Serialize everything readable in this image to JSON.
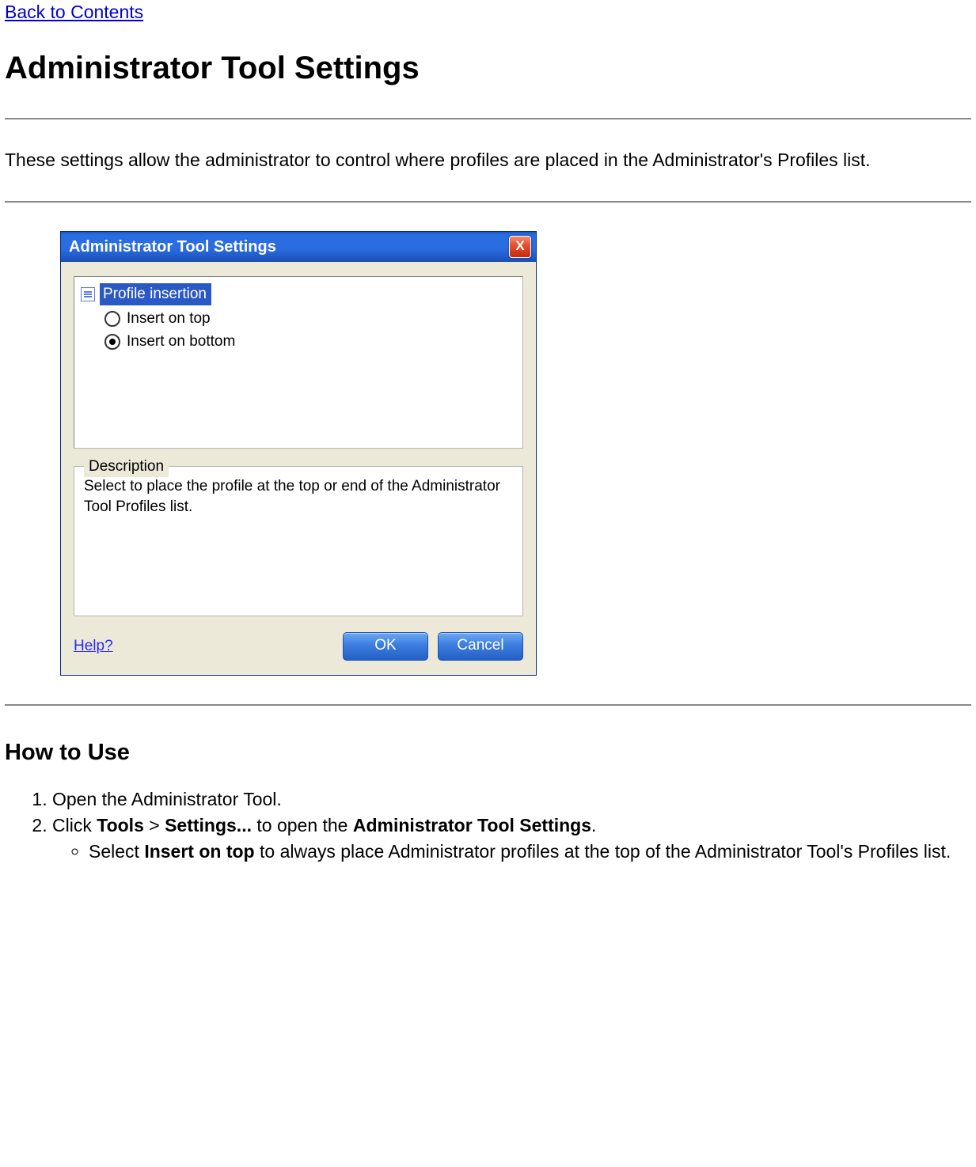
{
  "nav": {
    "back_label": "Back to Contents"
  },
  "heading": "Administrator Tool Settings",
  "intro": "These settings allow the administrator to control where profiles are placed in the Administrator's Profiles list.",
  "dialog": {
    "title": "Administrator Tool Settings",
    "close_label": "X",
    "group_label": "Profile insertion",
    "option_top": "Insert on top",
    "option_bottom": "Insert on bottom",
    "desc_legend": "Description",
    "desc_text": "Select to place the profile at the top or end of the Administrator Tool Profiles list.",
    "help_label": "Help?",
    "ok_label": "OK",
    "cancel_label": "Cancel"
  },
  "howto": {
    "heading": "How to Use",
    "step1": "Open the Administrator Tool.",
    "step2_prefix": "Click ",
    "step2_b1": "Tools",
    "step2_mid1": " > ",
    "step2_b2": "Settings...",
    "step2_mid2": " to open the ",
    "step2_b3": "Administrator Tool Settings",
    "step2_suffix": ".",
    "sub1_prefix": "Select ",
    "sub1_b": "Insert on top",
    "sub1_suffix": " to always place Administrator profiles at the top of the Administrator Tool's Profiles list."
  }
}
